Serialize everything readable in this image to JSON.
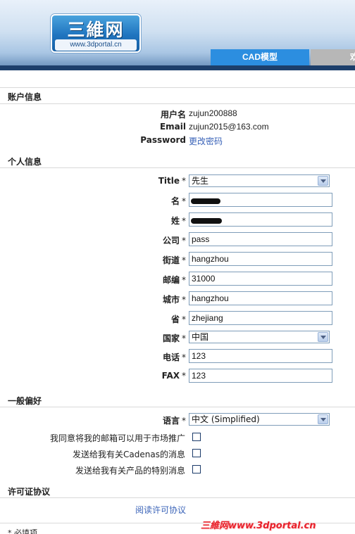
{
  "header": {
    "logo_title": "三維网",
    "logo_url": "www.3dportal.cn",
    "tabs": [
      {
        "label": "CAD模型"
      },
      {
        "label": "欢"
      }
    ]
  },
  "account": {
    "section_title": "账户信息",
    "username_label": "用户名",
    "username_value": "zujun200888",
    "email_label": "Email",
    "email_value": "zujun2015@163.com",
    "password_label": "Password",
    "password_link": "更改密码"
  },
  "personal": {
    "section_title": "个人信息",
    "title_label": "Title",
    "title_value": "先生",
    "first_name_label": "名",
    "last_name_label": "姓",
    "company_label": "公司",
    "company_value": "pass",
    "street_label": "街道",
    "street_value": "hangzhou",
    "zip_label": "邮编",
    "zip_value": "31000",
    "city_label": "城市",
    "city_value": "hangzhou",
    "province_label": "省",
    "province_value": "zhejiang",
    "country_label": "国家",
    "country_value": "中国",
    "phone_label": "电话",
    "phone_value": "123",
    "fax_label": "FAX",
    "fax_value": "123",
    "required_mark": "*"
  },
  "preferences": {
    "section_title": "一般偏好",
    "language_label": "语言",
    "language_value": "中文 (Simplified)",
    "opt_marketing": "我同意将我的邮箱可以用于市场推广",
    "opt_cadenas": "发送给我有关Cadenas的消息",
    "opt_products": "发送给我有关产品的特别消息"
  },
  "license": {
    "section_title": "许可证协议",
    "read_link": "阅读许可协议"
  },
  "footnote": "* 必填项",
  "watermark": "三維网www.3dportal.cn",
  "colors": {
    "tab_active": "#2c8ee0",
    "link": "#3a63b8",
    "watermark": "#e8212b"
  }
}
